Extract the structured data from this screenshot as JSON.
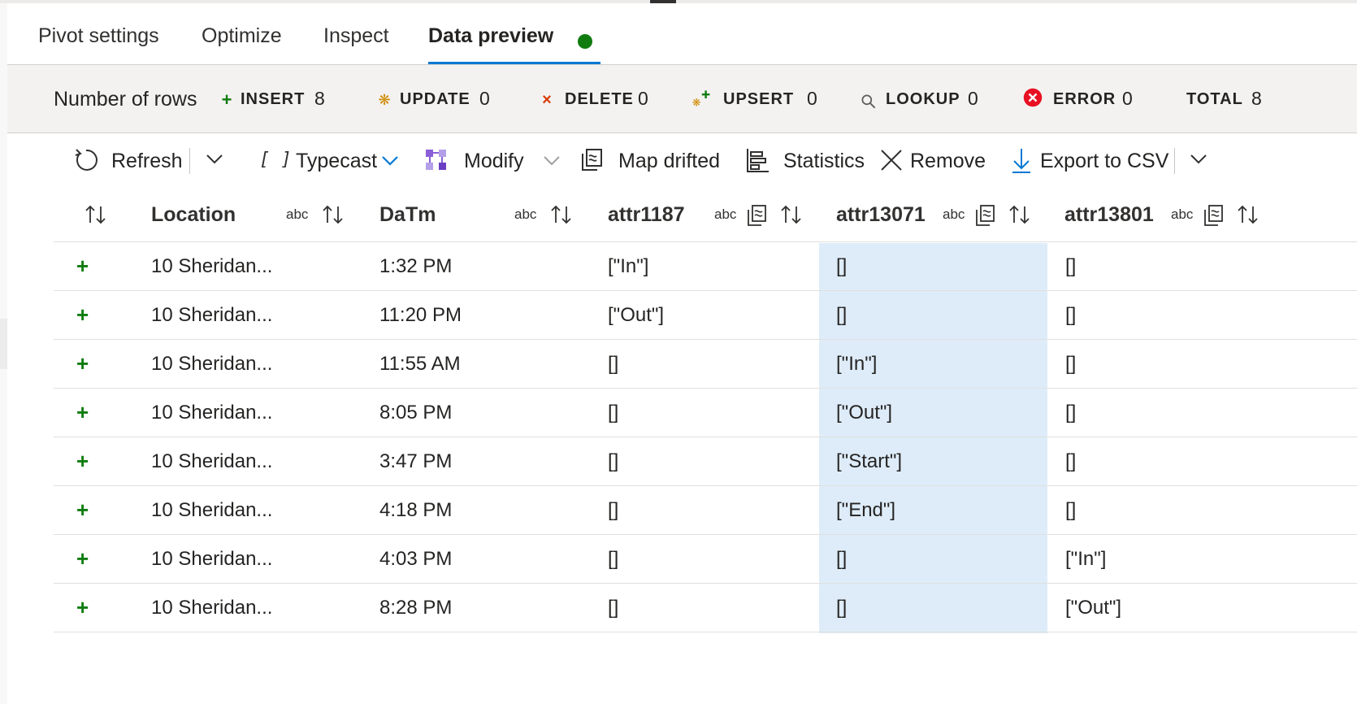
{
  "tabs": [
    {
      "label": "Pivot settings"
    },
    {
      "label": "Optimize"
    },
    {
      "label": "Inspect"
    },
    {
      "label": "Data preview"
    }
  ],
  "summary": {
    "title": "Number of rows",
    "stats": [
      {
        "label": "INSERT",
        "value": "8"
      },
      {
        "label": "UPDATE",
        "value": "0"
      },
      {
        "label": "DELETE",
        "value": "0"
      },
      {
        "label": "UPSERT",
        "value": "0"
      },
      {
        "label": "LOOKUP",
        "value": "0"
      },
      {
        "label": "ERROR",
        "value": "0"
      },
      {
        "label": "TOTAL",
        "value": "8"
      }
    ]
  },
  "toolbar": {
    "refresh": "Refresh",
    "typecast": "Typecast",
    "modify": "Modify",
    "map_drifted": "Map drifted",
    "statistics": "Statistics",
    "remove": "Remove",
    "export": "Export to CSV"
  },
  "columns": [
    {
      "name": "Location",
      "type": "abc"
    },
    {
      "name": "DaTm",
      "type": "abc"
    },
    {
      "name": "attr1187",
      "type": "abc"
    },
    {
      "name": "attr13071",
      "type": "abc"
    },
    {
      "name": "attr13801",
      "type": "abc"
    }
  ],
  "rows": [
    [
      "10 Sheridan...",
      "1:32 PM",
      "[\"In\"]",
      "[]",
      "[]"
    ],
    [
      "10 Sheridan...",
      "11:20 PM",
      "[\"Out\"]",
      "[]",
      "[]"
    ],
    [
      "10 Sheridan...",
      "11:55 AM",
      "[]",
      "[\"In\"]",
      "[]"
    ],
    [
      "10 Sheridan...",
      "8:05 PM",
      "[]",
      "[\"Out\"]",
      "[]"
    ],
    [
      "10 Sheridan...",
      "3:47 PM",
      "[]",
      "[\"Start\"]",
      "[]"
    ],
    [
      "10 Sheridan...",
      "4:18 PM",
      "[]",
      "[\"End\"]",
      "[]"
    ],
    [
      "10 Sheridan...",
      "4:03 PM",
      "[]",
      "[]",
      "[\"In\"]"
    ],
    [
      "10 Sheridan...",
      "8:28 PM",
      "[]",
      "[]",
      "[\"Out\"]"
    ]
  ],
  "colors": {
    "accent": "#0078d4",
    "insert": "#107c10",
    "update": "#d08a00",
    "delete": "#d83b01",
    "error": "#e81123",
    "selected_column": "#deecf9"
  }
}
